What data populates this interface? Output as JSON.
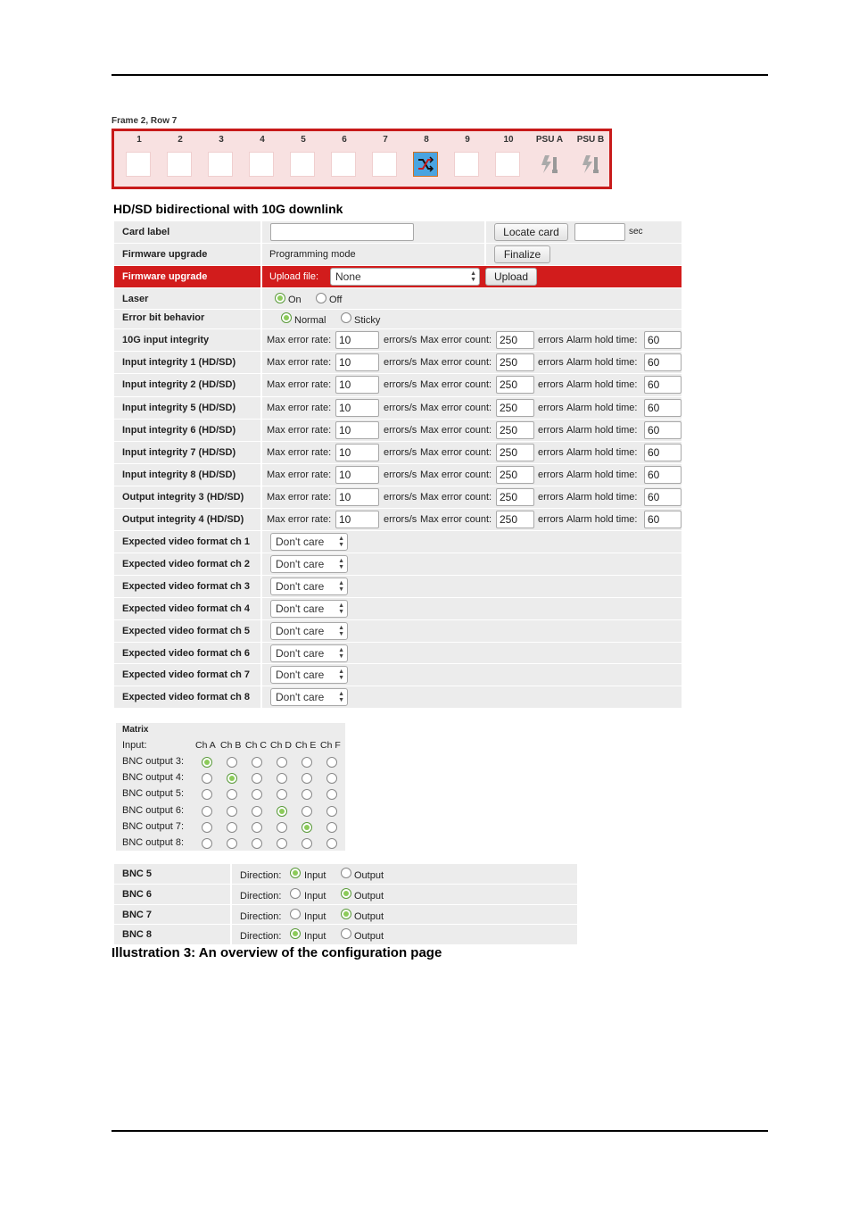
{
  "frame": {
    "label": "Frame 2, Row 7",
    "slots": [
      "1",
      "2",
      "3",
      "4",
      "5",
      "6",
      "7",
      "8",
      "9",
      "10",
      "PSU A",
      "PSU B"
    ],
    "active_slot": "8",
    "accent_color": "#c81a1a"
  },
  "heading": "HD/SD bidirectional with 10G downlink",
  "card_label": {
    "label": "Card label",
    "value": "",
    "locate_button": "Locate card",
    "locate_seconds": "",
    "sec_label": "sec"
  },
  "firmware": {
    "label": "Firmware upgrade",
    "mode": "Programming mode",
    "finalize_button": "Finalize"
  },
  "firmware_upload": {
    "label": "Firmware upgrade",
    "upload_file_label": "Upload file:",
    "file_value": "None",
    "upload_button": "Upload"
  },
  "laser": {
    "label": "Laser",
    "options": [
      "On",
      "Off"
    ],
    "selected": "On"
  },
  "error_bit": {
    "label": "Error bit behavior",
    "options": [
      "Normal",
      "Sticky"
    ],
    "selected": "Normal"
  },
  "integrity_labels": {
    "max_rate": "Max error rate:",
    "errors_s": "errors/s",
    "max_count": "Max error count:",
    "errors": "errors",
    "hold": "Alarm hold time:"
  },
  "integrity_rows": [
    {
      "label": "10G input integrity",
      "rate": "10",
      "count": "250",
      "hold": "60"
    },
    {
      "label": "Input integrity 1 (HD/SD)",
      "rate": "10",
      "count": "250",
      "hold": "60"
    },
    {
      "label": "Input integrity 2 (HD/SD)",
      "rate": "10",
      "count": "250",
      "hold": "60"
    },
    {
      "label": "Input integrity 5 (HD/SD)",
      "rate": "10",
      "count": "250",
      "hold": "60"
    },
    {
      "label": "Input integrity 6 (HD/SD)",
      "rate": "10",
      "count": "250",
      "hold": "60"
    },
    {
      "label": "Input integrity 7 (HD/SD)",
      "rate": "10",
      "count": "250",
      "hold": "60"
    },
    {
      "label": "Input integrity 8 (HD/SD)",
      "rate": "10",
      "count": "250",
      "hold": "60"
    },
    {
      "label": "Output integrity 3 (HD/SD)",
      "rate": "10",
      "count": "250",
      "hold": "60"
    },
    {
      "label": "Output integrity 4 (HD/SD)",
      "rate": "10",
      "count": "250",
      "hold": "60"
    }
  ],
  "format_rows": [
    {
      "label": "Expected video format ch 1",
      "value": "Don't care"
    },
    {
      "label": "Expected video format ch 2",
      "value": "Don't care"
    },
    {
      "label": "Expected video format ch 3",
      "value": "Don't care"
    },
    {
      "label": "Expected video format ch 4",
      "value": "Don't care"
    },
    {
      "label": "Expected video format ch 5",
      "value": "Don't care"
    },
    {
      "label": "Expected video format ch 6",
      "value": "Don't care"
    },
    {
      "label": "Expected video format ch 7",
      "value": "Don't care"
    },
    {
      "label": "Expected video format ch 8",
      "value": "Don't care"
    }
  ],
  "matrix": {
    "title": "Matrix",
    "input_label": "Input:",
    "columns": [
      "Ch A",
      "Ch B",
      "Ch C",
      "Ch D",
      "Ch E",
      "Ch F"
    ],
    "rows": [
      {
        "label": "BNC output 3:",
        "selected": 0
      },
      {
        "label": "BNC output 4:",
        "selected": 1
      },
      {
        "label": "BNC output 5:",
        "selected": -1
      },
      {
        "label": "BNC output 6:",
        "selected": 3
      },
      {
        "label": "BNC output 7:",
        "selected": 4
      },
      {
        "label": "BNC output 8:",
        "selected": -1
      }
    ]
  },
  "bnc": {
    "direction_label": "Direction:",
    "options": [
      "Input",
      "Output"
    ],
    "rows": [
      {
        "label": "BNC 5",
        "selected": "Input"
      },
      {
        "label": "BNC 6",
        "selected": "Output"
      },
      {
        "label": "BNC 7",
        "selected": "Output"
      },
      {
        "label": "BNC 8",
        "selected": "Input"
      }
    ]
  },
  "caption": "Illustration 3: An overview of the configuration page"
}
